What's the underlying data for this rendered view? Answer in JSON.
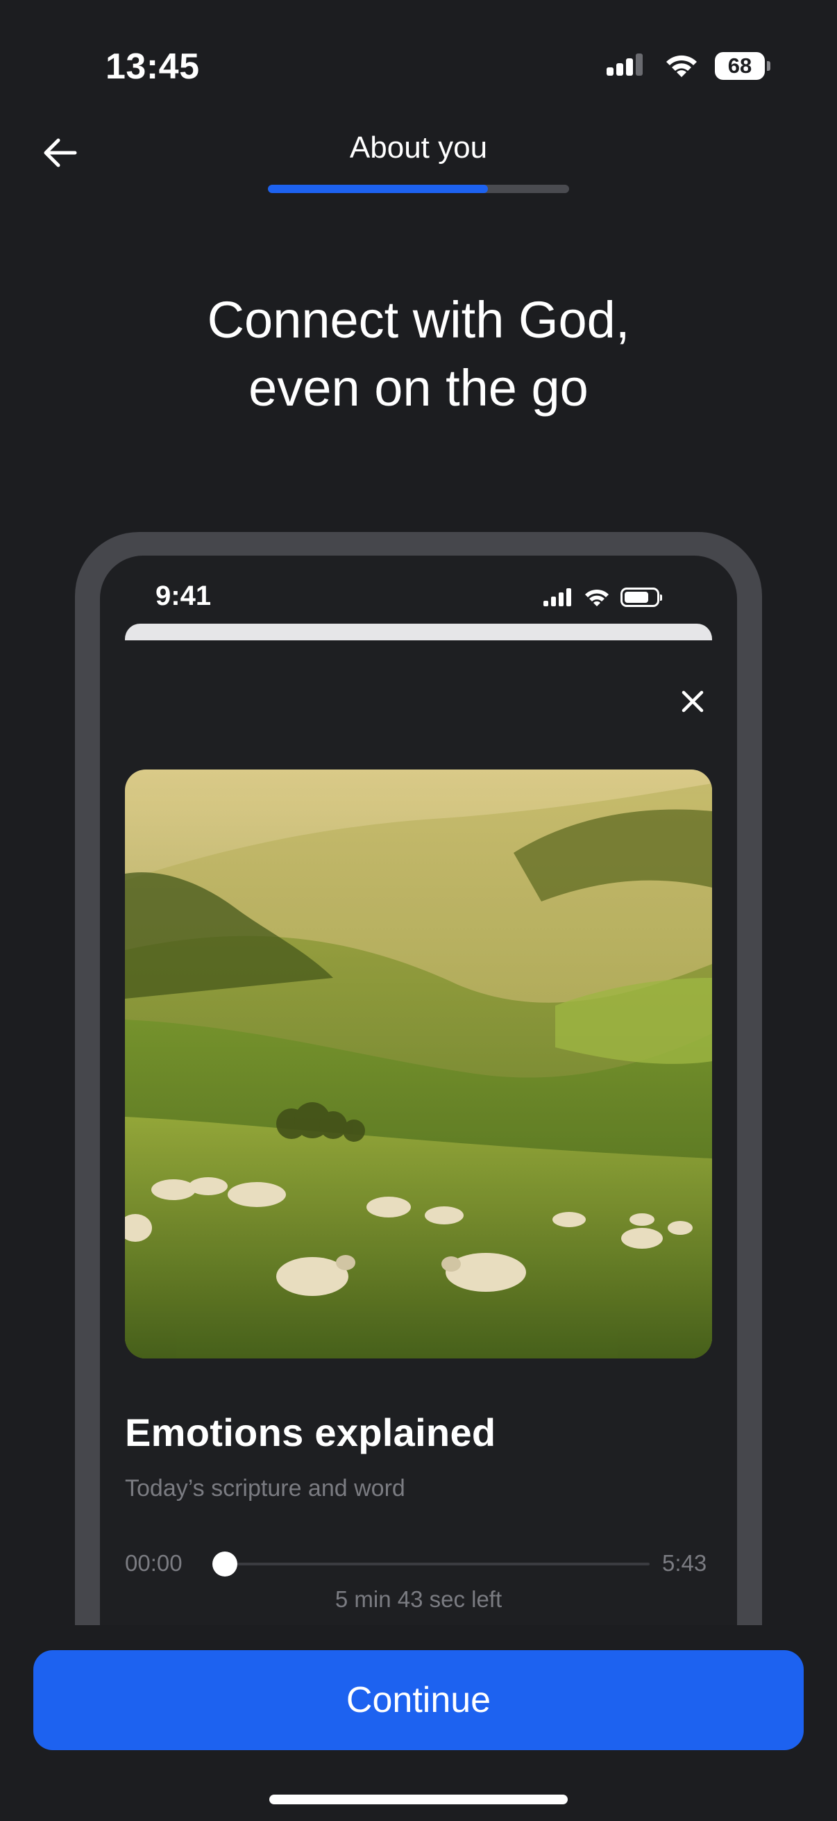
{
  "status_bar": {
    "time": "13:45",
    "battery": "68",
    "icons": [
      "cellular-signal-icon",
      "wifi-icon",
      "battery-icon"
    ]
  },
  "nav": {
    "back_icon": "arrow-left-icon",
    "title": "About you",
    "progress": 0.73
  },
  "headline": {
    "line1": "Connect with God,",
    "line2": "even on the go"
  },
  "mockup": {
    "status_time": "9:41",
    "close_icon": "close-icon",
    "image": "rolling-hills-with-grazing-sheep",
    "title": "Emotions explained",
    "subtitle": "Today’s scripture and word",
    "time_start": "00:00",
    "time_end": "5:43",
    "time_left": "5 min 43 sec left",
    "scrubber_position": 0
  },
  "continue_label": "Continue",
  "colors": {
    "background": "#1c1d20",
    "accent": "#1d62f0",
    "frame": "#46474c",
    "muted_text": "#7b7c82"
  }
}
